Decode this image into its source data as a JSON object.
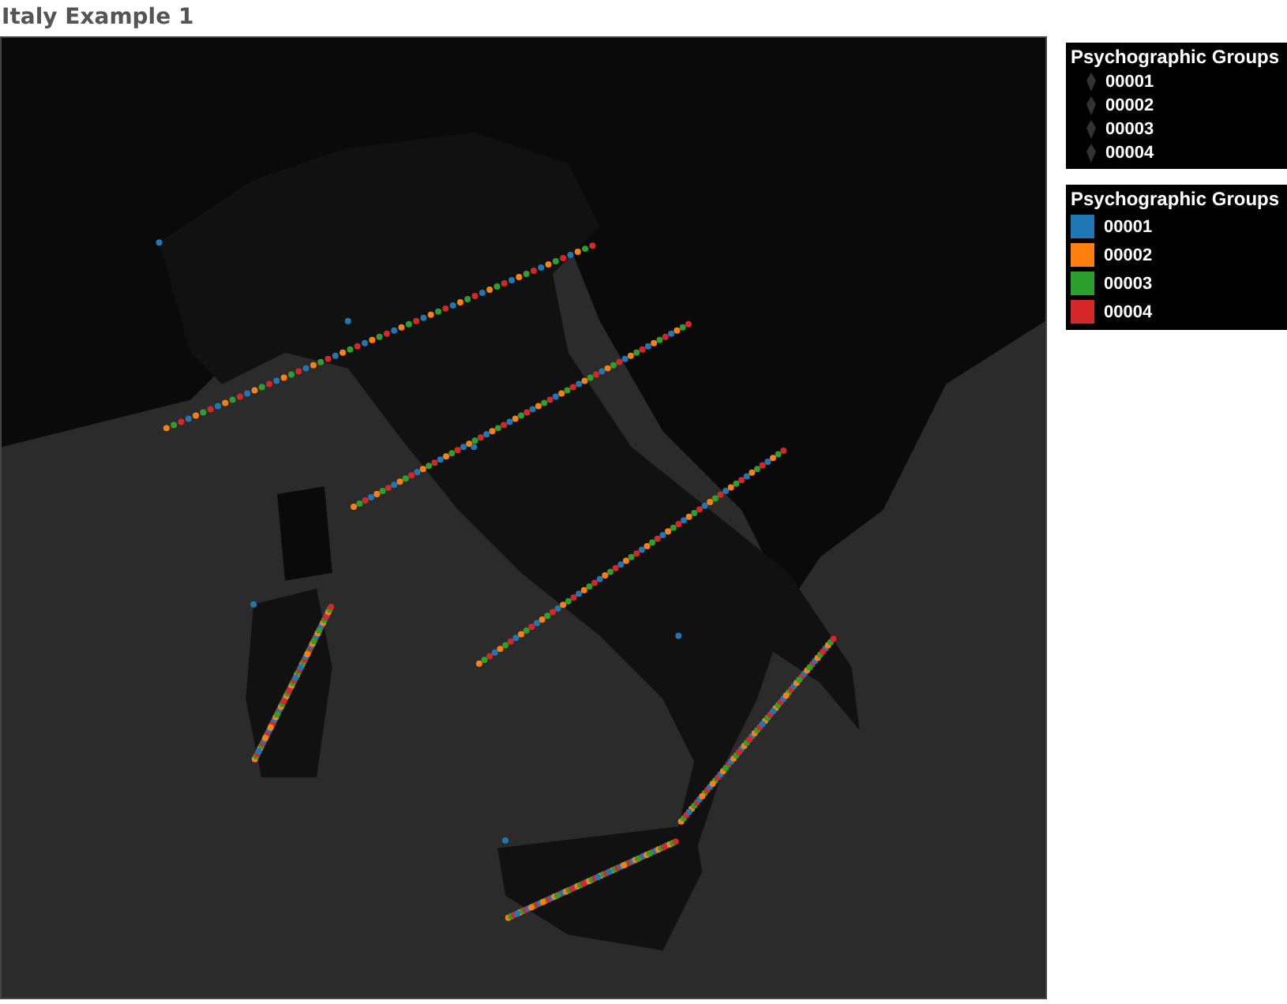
{
  "title": "Italy Example 1",
  "shape_legend": {
    "title": "Psychographic Groups",
    "items": [
      {
        "label": "00001"
      },
      {
        "label": "00002"
      },
      {
        "label": "00003"
      },
      {
        "label": "00004"
      }
    ]
  },
  "color_legend": {
    "title": "Psychographic Groups",
    "items": [
      {
        "label": "00001",
        "color": "#1f77b4"
      },
      {
        "label": "00002",
        "color": "#ff7f0e"
      },
      {
        "label": "00003",
        "color": "#2ca02c"
      },
      {
        "label": "00004",
        "color": "#d62728"
      }
    ]
  }
}
